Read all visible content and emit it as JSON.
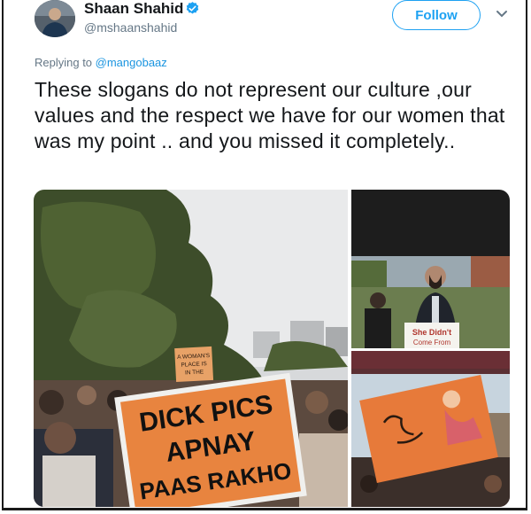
{
  "tweet": {
    "display_name": "Shaan Shahid",
    "handle": "@mshaanshahid",
    "follow_label": "Follow",
    "replying_prefix": "Replying to ",
    "replying_to": "@mangobaaz",
    "text": "These slogans do not represent our culture ,our values and the respect we have for our women that was my point .. and you missed it completely.."
  },
  "media": {
    "main_sign": [
      "DICK PICS",
      "APNAY",
      "PAAS RAKHO"
    ],
    "small_sign": [
      "A WOMAN'S",
      "PLACE IS",
      "IN THE"
    ],
    "man_sign": [
      "She Didn't",
      "Come From"
    ]
  },
  "colors": {
    "accent": "#1da1f2",
    "verified": "#1da1f2",
    "text": "#14171a",
    "muted": "#657786"
  }
}
